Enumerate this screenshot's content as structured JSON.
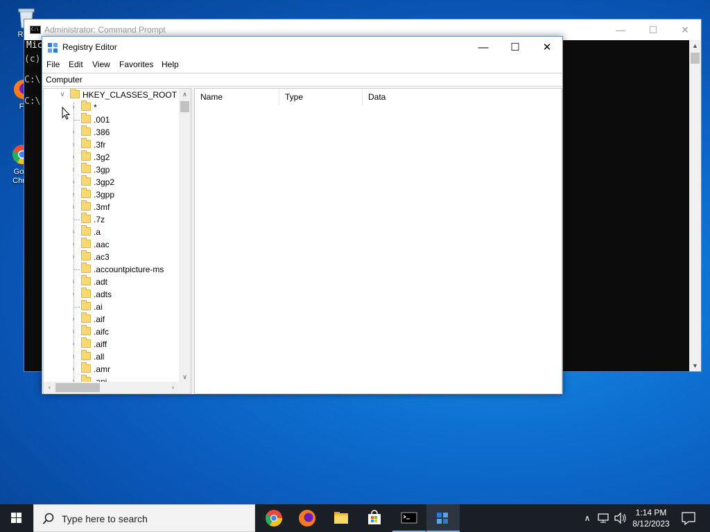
{
  "desktop": {
    "icons": [
      {
        "label": "Recy",
        "name": "recycle-bin"
      },
      {
        "label": "Fir",
        "name": "firefox"
      },
      {
        "label": "Go Chr",
        "name": "google-chrome"
      }
    ]
  },
  "cmd": {
    "title": "Administrator: Command Prompt",
    "lines": [
      "Mic",
      "(c)",
      "",
      "C:\\",
      "",
      "C:\\"
    ]
  },
  "regedit": {
    "title": "Registry Editor",
    "menu": [
      "File",
      "Edit",
      "View",
      "Favorites",
      "Help"
    ],
    "address": "Computer",
    "root_key": "HKEY_CLASSES_ROOT",
    "keys": [
      {
        "label": "*",
        "expandable": true
      },
      {
        "label": ".001",
        "expandable": false
      },
      {
        "label": ".386",
        "expandable": true
      },
      {
        "label": ".3fr",
        "expandable": true
      },
      {
        "label": ".3g2",
        "expandable": true
      },
      {
        "label": ".3gp",
        "expandable": true
      },
      {
        "label": ".3gp2",
        "expandable": true
      },
      {
        "label": ".3gpp",
        "expandable": true
      },
      {
        "label": ".3mf",
        "expandable": true
      },
      {
        "label": ".7z",
        "expandable": false
      },
      {
        "label": ".a",
        "expandable": true
      },
      {
        "label": ".aac",
        "expandable": true
      },
      {
        "label": ".ac3",
        "expandable": true
      },
      {
        "label": ".accountpicture-ms",
        "expandable": false
      },
      {
        "label": ".adt",
        "expandable": true
      },
      {
        "label": ".adts",
        "expandable": true
      },
      {
        "label": ".ai",
        "expandable": false
      },
      {
        "label": ".aif",
        "expandable": true
      },
      {
        "label": ".aifc",
        "expandable": true
      },
      {
        "label": ".aiff",
        "expandable": true
      },
      {
        "label": ".all",
        "expandable": true
      },
      {
        "label": ".amr",
        "expandable": true
      },
      {
        "label": ".api",
        "expandable": true
      }
    ],
    "columns": [
      "Name",
      "Type",
      "Data"
    ]
  },
  "taskbar": {
    "search_placeholder": "Type here to search",
    "time": "1:14 PM",
    "date": "8/12/2023",
    "apps": [
      "chrome",
      "firefox",
      "file-explorer",
      "store",
      "command-prompt",
      "registry-editor"
    ]
  }
}
